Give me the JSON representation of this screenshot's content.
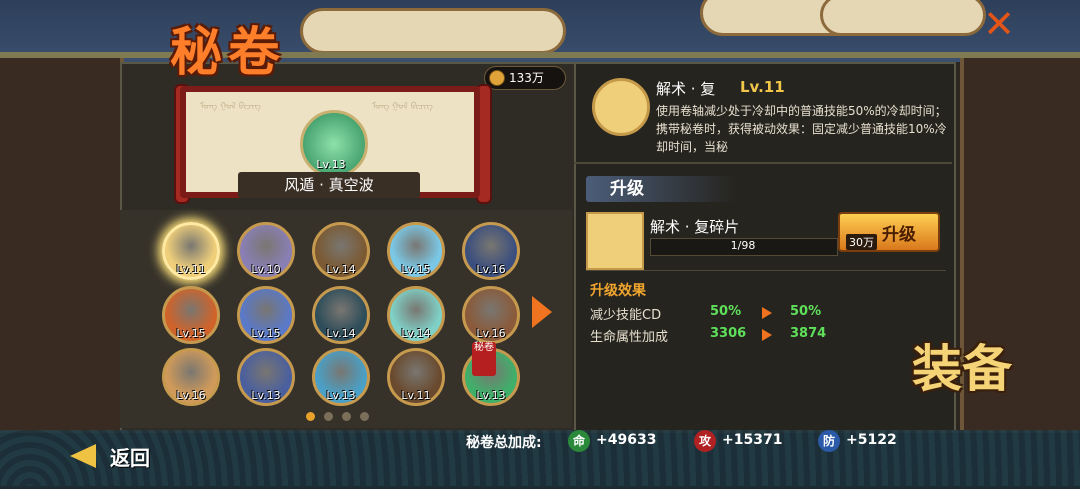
{
  "header": {
    "title": "秘卷",
    "close_icon": "close-x-icon"
  },
  "currency": {
    "amount": "133万",
    "icon": "coin-icon"
  },
  "scroll": {
    "featured_level": "Lv.13",
    "featured_name": "风遁 · 真空波",
    "script_lines": [
      "ᠮᠣᠩ ᠭᠣᠯ ᠪᠢᠴᠢᠭ",
      "ᠮᠣᠩ ᠭᠣᠯ ᠪᠢᠴᠢᠭ"
    ]
  },
  "grid": {
    "items": [
      {
        "level": "Lv.11",
        "color": "#efcf7a",
        "selected": true
      },
      {
        "level": "Lv.10",
        "color": "#8a7fb4",
        "selected": false
      },
      {
        "level": "Lv.14",
        "color": "#7b5a33",
        "selected": false
      },
      {
        "level": "Lv.15",
        "color": "#7bc8e6",
        "selected": false
      },
      {
        "level": "Lv.16",
        "color": "#3b4f7e",
        "selected": false
      },
      {
        "level": "Lv.15",
        "color": "#d0632a",
        "selected": false
      },
      {
        "level": "Lv.15",
        "color": "#5a79c8",
        "selected": false
      },
      {
        "level": "Lv.14",
        "color": "#2e4d5a",
        "selected": false
      },
      {
        "level": "Lv.14",
        "color": "#7fd0c6",
        "selected": false
      },
      {
        "level": "Lv.16",
        "color": "#8a5a3a",
        "selected": false
      },
      {
        "level": "Lv.16",
        "color": "#d09a5a",
        "selected": false
      },
      {
        "level": "Lv.13",
        "color": "#4a5f9e",
        "selected": false
      },
      {
        "level": "Lv.13",
        "color": "#4aa0c6",
        "selected": false
      },
      {
        "level": "Lv.11",
        "color": "#6a4a2e",
        "selected": false
      },
      {
        "level": "Lv.13",
        "color": "#3fb06a",
        "selected": false
      }
    ],
    "special_badge": "秘卷",
    "page_dots": 4,
    "page_active": 0
  },
  "skill": {
    "name": "解术 · 复",
    "level": "Lv.11",
    "description": "使用卷轴减少处于冷却中的普通技能50%的冷却时间；携带秘卷时，获得被动效果：固定减少普通技能10%冷却时间，当秘"
  },
  "upgrade": {
    "heading": "升级",
    "fragment_name": "解术 · 复碎片",
    "fragment_progress": "1/98",
    "cost": "30万",
    "button_label": "升级",
    "effects_heading": "升级效果",
    "effects": [
      {
        "label": "减少技能CD",
        "current": "50%",
        "next": "50%"
      },
      {
        "label": "生命属性加成",
        "current": "3306",
        "next": "3874"
      }
    ]
  },
  "bottom": {
    "back_label": "返回",
    "bonus_label": "秘卷总加成:",
    "stats": [
      {
        "icon_text": "命",
        "value": "+49633",
        "color": "#2a8a3a"
      },
      {
        "icon_text": "攻",
        "value": "+15371",
        "color": "#b02222"
      },
      {
        "icon_text": "防",
        "value": "+5122",
        "color": "#2b5aa8"
      }
    ]
  },
  "side_badge": "装备"
}
